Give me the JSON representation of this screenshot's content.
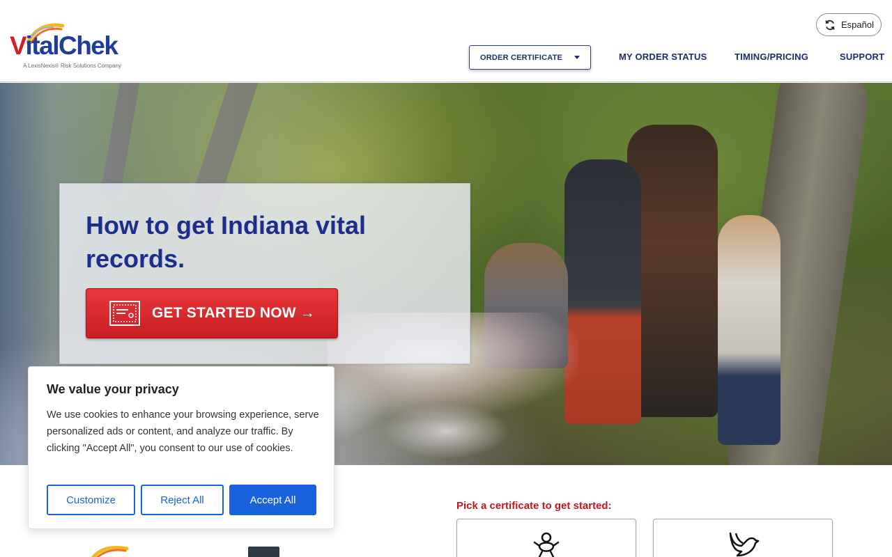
{
  "brand": {
    "name_initial": "V",
    "name_rest": "italChek",
    "tagline": "A LexisNexis® Risk Solutions Company"
  },
  "header": {
    "language_button": "Español",
    "order_dropdown": "ORDER CERTIFICATE",
    "nav": {
      "order_status": "MY ORDER STATUS",
      "timing_pricing": "TIMING/PRICING",
      "support": "SUPPORT"
    }
  },
  "hero": {
    "title": "How to get Indiana vital records.",
    "cta_label": "GET STARTED NOW →"
  },
  "certificates": {
    "pick_label": "Pick a certificate to get started:",
    "cards": [
      {
        "icon": "baby-icon"
      },
      {
        "icon": "dove-icon"
      }
    ]
  },
  "cookie_banner": {
    "title": "We value your privacy",
    "text": "We use cookies to enhance your browsing experience, serve personalized ads or content, and analyze our traffic. By clicking \"Accept All\", you consent to our use of cookies.",
    "customize": "Customize",
    "reject": "Reject All",
    "accept": "Accept All"
  },
  "colors": {
    "brand_blue": "#1d2d8c",
    "brand_red": "#d31f26",
    "cookie_accent": "#1863dc"
  }
}
